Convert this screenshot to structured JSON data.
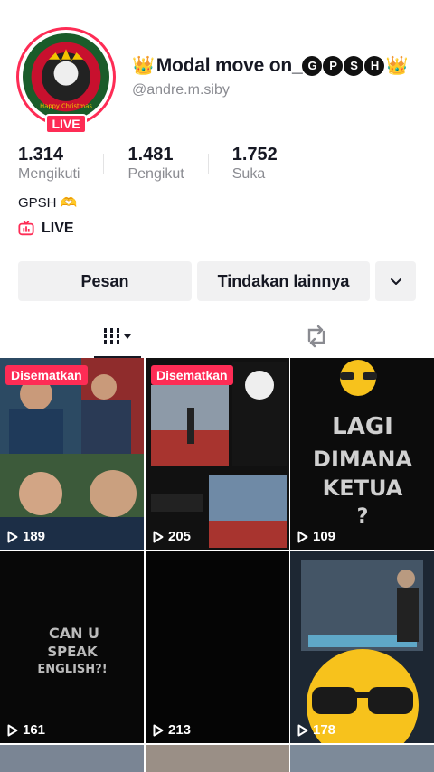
{
  "profile": {
    "display_name": "Modal move on_",
    "display_letters": [
      "G",
      "P",
      "S",
      "H"
    ],
    "username": "@andre.m.siby",
    "live_badge": "LIVE",
    "bio": "GPSH 🫶",
    "live_link": "LIVE",
    "avatar_text": "Happy Christmas"
  },
  "stats": [
    {
      "value": "1.314",
      "label": "Mengikuti"
    },
    {
      "value": "1.481",
      "label": "Pengikut"
    },
    {
      "value": "1.752",
      "label": "Suka"
    }
  ],
  "actions": {
    "message": "Pesan",
    "more": "Tindakan lainnya"
  },
  "videos": [
    {
      "pinned": "Disematkan",
      "views": "189"
    },
    {
      "pinned": "Disematkan",
      "views": "205"
    },
    {
      "views": "109",
      "caption": "LAGI DIMANA KETUA ?"
    },
    {
      "views": "161",
      "caption": "CAN U SPEAK ENGLISH?!"
    },
    {
      "views": "213"
    },
    {
      "views": "178"
    }
  ],
  "colors": {
    "accent": "#fe2c55",
    "text": "#161823",
    "muted": "#8a8b91",
    "button_bg": "#f1f1f2"
  }
}
